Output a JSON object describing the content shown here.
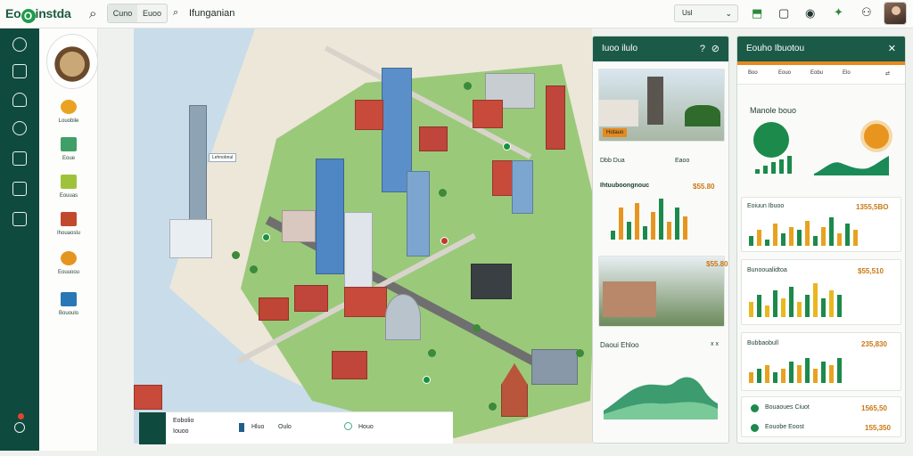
{
  "app": {
    "title": "Eo",
    "title_mid": "O",
    "title_end": "instda",
    "accent": "#0f4a3e",
    "brand_green": "#1f9a4b",
    "orange": "#e58a1f"
  },
  "toolbar": {
    "seg_left": "Cuno",
    "seg_right": "Euoo",
    "crumb": "Ifunganian",
    "select_value": "Usl",
    "icons": [
      "search-icon",
      "map-pin-icon",
      "bookmark-icon",
      "bag-icon",
      "location-icon",
      "cart-icon",
      "robot-icon"
    ]
  },
  "sidebar": {
    "rail_icons": [
      "layers-icon",
      "info-icon",
      "users-icon",
      "compass-icon",
      "chart-icon",
      "image-icon",
      "grid-icon"
    ],
    "categories": [
      {
        "label": "Louobile",
        "icon": "lightbulb-icon",
        "color": "#e9a321"
      },
      {
        "label": "Eoue",
        "icon": "landmark-icon",
        "color": "#3f9f66"
      },
      {
        "label": "Eouuas",
        "icon": "house-icon",
        "color": "#9fc23b"
      },
      {
        "label": "Ihouaoslu",
        "icon": "temple-icon",
        "color": "#c14a2d"
      },
      {
        "label": "Eouuoou",
        "icon": "sun-icon",
        "color": "#e69420"
      },
      {
        "label": "Bououlo",
        "icon": "building-icon",
        "color": "#2b76b5"
      }
    ]
  },
  "map": {
    "tag": "Lehnobnul",
    "bottom": {
      "title": "Eobolio",
      "sub": "Iouoo",
      "action1": "Hluo",
      "action2": "Oulo",
      "action3": "Houo"
    }
  },
  "detail_panel": {
    "title": "Iuoo ilulo",
    "header_icons": [
      "help-icon",
      "tag-icon"
    ],
    "photo_label": "Hotauo",
    "mini_stats": "Dbb Dua",
    "mini_count": "Eaoo",
    "section": "Ihtuuboongnouc",
    "section_value": "$55.80",
    "card2_value": "$55.80",
    "chart_title": "Daoui Ehloo",
    "chart_icons": "x x"
  },
  "stats_panel": {
    "title": "Eouho Ibuotou",
    "tabs": [
      "Boo",
      "Eouo",
      "Eobu",
      "Elo"
    ],
    "summary_title": "Manole bouo",
    "cards": [
      {
        "label": "Eoiuun Ibuoo",
        "value": "1355,5BO",
        "values": [
          3,
          5,
          2,
          7,
          4,
          6,
          5,
          8,
          3,
          6,
          9,
          4,
          7,
          5
        ]
      },
      {
        "label": "Bunooualidtoa",
        "value": "$55,510",
        "values": [
          4,
          6,
          3,
          7,
          5,
          8,
          4,
          6,
          9,
          5,
          7,
          6
        ]
      },
      {
        "label": "Bubbaobull",
        "value": "235,830",
        "values": [
          3,
          4,
          5,
          3,
          4,
          6,
          5,
          7,
          4,
          6,
          5,
          7
        ]
      },
      {
        "label": "Bouaoues Ciuot",
        "value": "1565,50"
      },
      {
        "label": "Eouobe Eoost",
        "value": "155,350"
      }
    ]
  }
}
